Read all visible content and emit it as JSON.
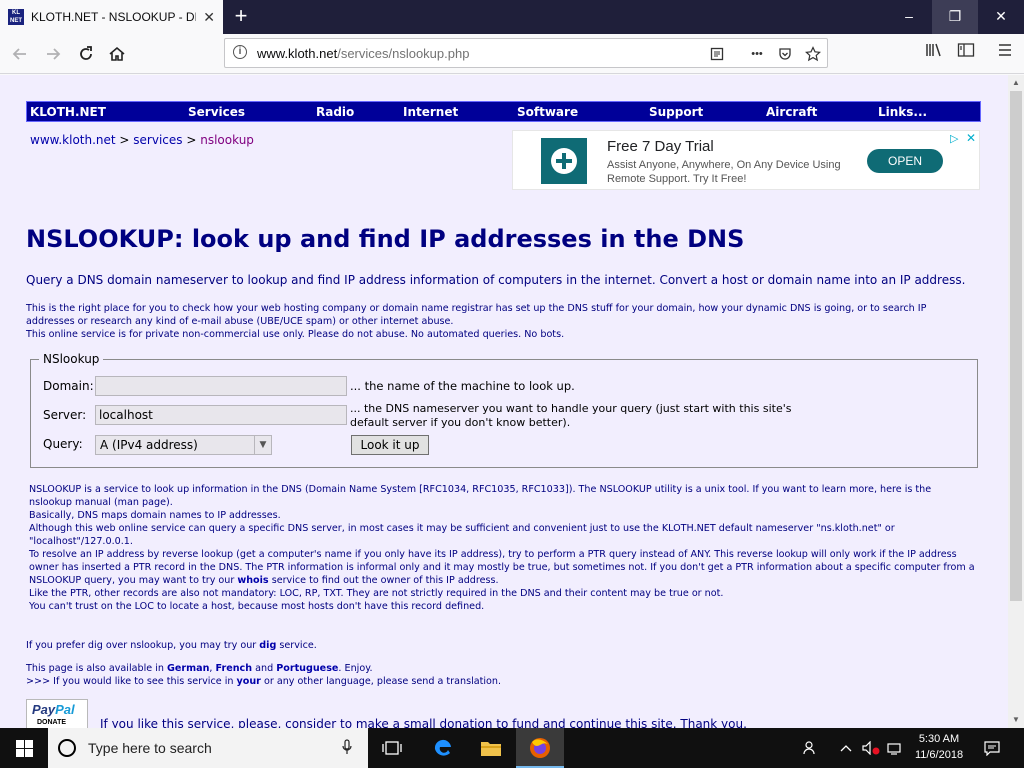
{
  "browser": {
    "tab_title": "KLOTH.NET - NSLOOKUP - DN",
    "favicon_text": "KL NET",
    "new_tab_symbol": "+",
    "url_prefix": "www.kloth.net",
    "url_path": "/services/nslookup.php",
    "page_actions_symbol": "•••",
    "window_min": "–",
    "window_max": "❐",
    "window_close": "✕"
  },
  "site_nav": {
    "items": [
      "KLOTH.NET",
      "Services",
      "Radio",
      "Internet",
      "Software",
      "Support",
      "Aircraft",
      "Links..."
    ]
  },
  "breadcrumb": {
    "home": "www.kloth.net",
    "sep1": " > ",
    "section": "services",
    "sep2": " > ",
    "current": "nslookup"
  },
  "ad": {
    "title": "Free 7 Day Trial",
    "description": "Assist Anyone, Anywhere, On Any Device Using Remote Support. Try It Free!",
    "button": "OPEN",
    "choices_symbol": "▷",
    "close_symbol": "✕",
    "colors": {
      "brand": "#0f6b75"
    }
  },
  "page": {
    "heading": "NSLOOKUP: look up and find IP addresses in the DNS",
    "intro": "Query a DNS domain nameserver to lookup and find IP address information of computers in the internet. Convert a host or domain name into an IP address.",
    "note_line1": "This is the right place for you to check how your web hosting company or domain name registrar has set up the DNS stuff for your domain, how your dynamic DNS is going, or to search IP addresses or research any kind of e-mail abuse (UBE/UCE spam) or other internet abuse.",
    "note_line2": "This online service is for private non-commercial use only. Please do not abuse. No automated queries. No bots."
  },
  "form": {
    "legend": "NSlookup",
    "domain_label": "Domain:",
    "domain_value": "",
    "domain_note": "... the name of the machine to look up.",
    "server_label": "Server:",
    "server_value": "localhost",
    "server_note_line1": "... the DNS nameserver you want to handle your query (just start with this site's",
    "server_note_line2": "default server if you don't know better).",
    "query_label": "Query:",
    "query_selected": "A (IPv4 address)",
    "submit_label": "Look it up"
  },
  "description": {
    "l1a": "NSLOOKUP is a service to look up information in the DNS (Domain Name System [RFC1034, RFC1035, RFC1033]). The NSLOOKUP utility is a unix tool. If you want to learn more, here is the",
    "l1b": "nslookup manual (man page).",
    "l2": "Basically, DNS maps domain names to IP addresses.",
    "l3a": "Although this web online service can query a specific DNS server, in most cases it may be sufficient and convenient just to use the KLOTH.NET default nameserver \"ns.kloth.net\" or",
    "l3b": "\"localhost\"/127.0.0.1.",
    "l4a": "To resolve an IP address by reverse lookup (get a computer's name if you only have its IP address), try to perform a PTR query instead of ANY. This reverse lookup will only work if the IP address",
    "l4b": "owner has inserted a PTR record in the DNS. The PTR information is informal only and it may mostly be true, but sometimes not. If you don't get a PTR information about a specific computer from a",
    "l4c_pre": "NSLOOKUP query, you may want to try our ",
    "l4c_link": "whois",
    "l4c_post": " service to find out the owner of this IP address.",
    "l5": "Like the PTR, other records are also not mandatory: LOC, RP, TXT. They are not strictly required in the DNS and their content may be true or not.",
    "l6": "You can't trust on the LOC to locate a host, because most hosts don't have this record defined."
  },
  "more": {
    "dig_pre": "If you prefer dig over nslookup, you may try our ",
    "dig_link": "dig",
    "dig_post": " service.",
    "lang_pre": "This page is also available in ",
    "lang_de": "German",
    "lang_sep1": ", ",
    "lang_fr": "French",
    "lang_sep2": " and ",
    "lang_pt": "Portuguese",
    "lang_post": ". Enjoy.",
    "trans_pre": ">>> If you would like to see this service in ",
    "trans_link": "your",
    "trans_post": " or any other language, please send a translation."
  },
  "donation": {
    "paypal_pay": "Pay",
    "paypal_pal": "Pal",
    "paypal_donate": "DONATE",
    "text": "If you like this service, please, consider to make a small donation to fund and continue this site. Thank you."
  },
  "taskbar": {
    "search_placeholder": "Type here to search",
    "time": "5:30 AM",
    "date": "11/6/2018"
  },
  "colors": {
    "nav_bg": "#000099",
    "page_bg": "#f2eefe",
    "heading": "#000080",
    "link": "#0000aa"
  }
}
